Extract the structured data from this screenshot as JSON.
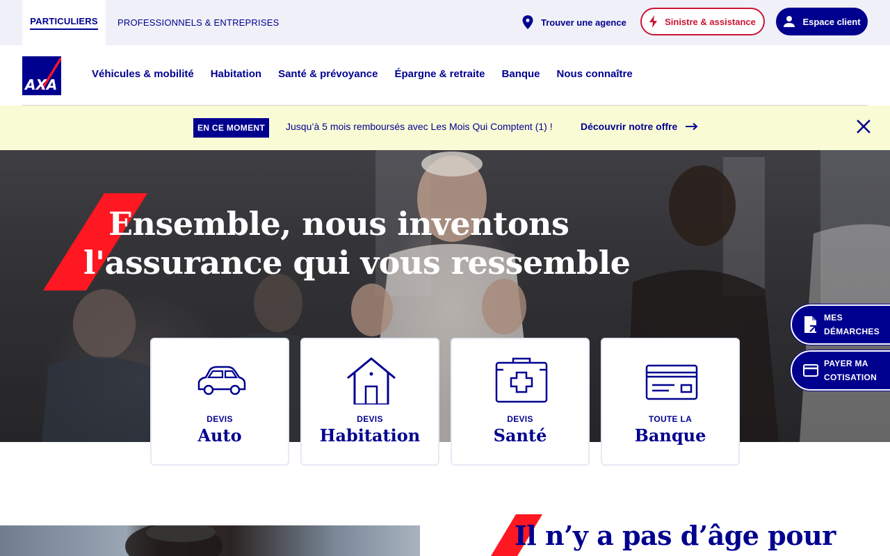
{
  "topbar": {
    "tabs": [
      {
        "label": "PARTICULIERS",
        "active": true
      },
      {
        "label": "PROFESSIONNELS & ENTREPRISES",
        "active": false
      }
    ],
    "find_agency": "Trouver une agence",
    "claim_button": "Sinistre & assistance",
    "account_button": "Espace client"
  },
  "nav": {
    "logo_text": "AXA",
    "items": [
      {
        "label": "Véhicules & mobilité"
      },
      {
        "label": "Habitation"
      },
      {
        "label": "Santé & prévoyance"
      },
      {
        "label": "Épargne & retraite"
      },
      {
        "label": "Banque"
      },
      {
        "label": "Nous connaître"
      }
    ]
  },
  "promo": {
    "badge": "EN CE MOMENT",
    "text": "Jusqu’à 5 mois remboursés avec Les Mois Qui Comptent (1) !",
    "link": "Découvrir notre offre"
  },
  "hero": {
    "title_line1": "Ensemble, nous inventons",
    "title_line2": "l'assurance qui vous ressemble"
  },
  "cards": [
    {
      "kicker": "DEVIS",
      "name": "Auto",
      "icon": "car-icon"
    },
    {
      "kicker": "DEVIS",
      "name": "Habitation",
      "icon": "house-icon"
    },
    {
      "kicker": "DEVIS",
      "name": "Santé",
      "icon": "medical-kit-icon"
    },
    {
      "kicker": "TOUTE LA",
      "name": "Banque",
      "icon": "credit-card-icon"
    }
  ],
  "side_buttons": [
    {
      "label": "MES DÉMARCHES",
      "icon": "document-icon"
    },
    {
      "label": "PAYER MA COTISATION",
      "icon": "card-icon"
    }
  ],
  "lower": {
    "title": "Il n’y a pas d’âge pour"
  },
  "colors": {
    "brand_blue": "#00008f",
    "brand_red": "#ff1721",
    "claim_red": "#c91432",
    "promo_bg": "#f9fbd5",
    "topbar_bg": "#f0f0f8"
  }
}
